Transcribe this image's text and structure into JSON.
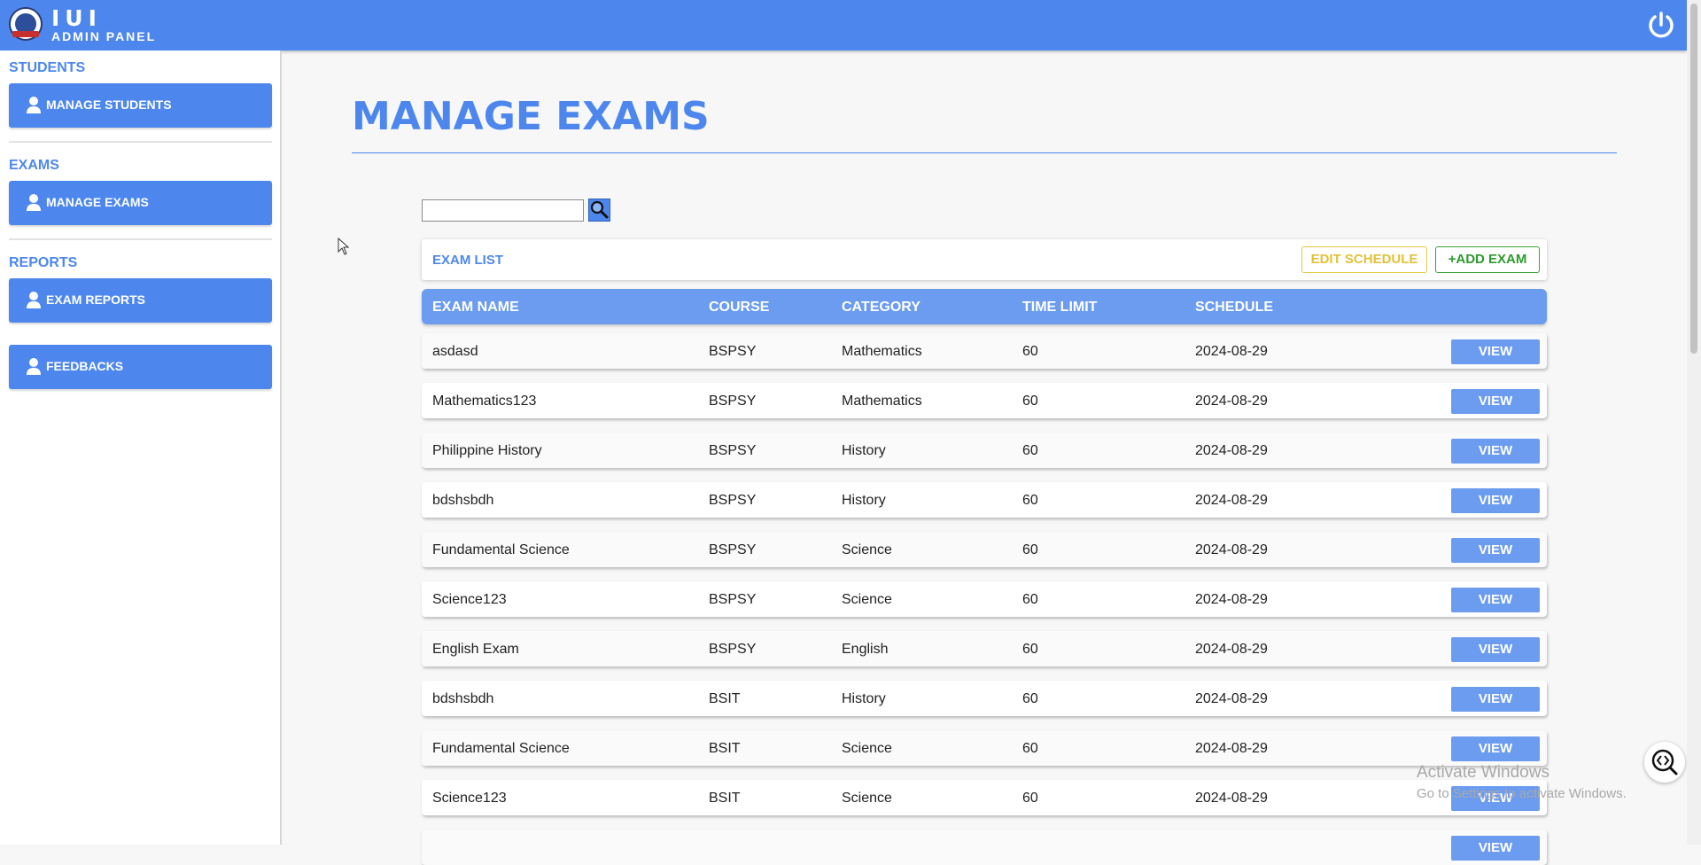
{
  "brand": {
    "title": "IUI",
    "subtitle": "ADMIN PANEL"
  },
  "sidebar": {
    "sections": [
      {
        "heading": "STUDENTS",
        "button": "MANAGE STUDENTS"
      },
      {
        "heading": "EXAMS",
        "button": "MANAGE EXAMS"
      },
      {
        "heading": "REPORTS",
        "button": "EXAM REPORTS"
      }
    ],
    "feedback_button": "FEEDBACKS",
    "icon": "user-icon"
  },
  "page": {
    "title": "MANAGE EXAMS",
    "search_value": "",
    "search_icon": "magnifier-icon"
  },
  "exam_list": {
    "title": "EXAM LIST",
    "edit_schedule_label": "EDIT SCHEDULE",
    "add_exam_label": "+ADD EXAM",
    "columns": [
      "EXAM NAME",
      "COURSE",
      "CATEGORY",
      "TIME LIMIT",
      "SCHEDULE"
    ],
    "view_label": "VIEW",
    "rows": [
      {
        "name": "asdasd",
        "course": "BSPSY",
        "category": "Mathematics",
        "time_limit": "60",
        "schedule": "2024-08-29"
      },
      {
        "name": "Mathematics123",
        "course": "BSPSY",
        "category": "Mathematics",
        "time_limit": "60",
        "schedule": "2024-08-29"
      },
      {
        "name": "Philippine History",
        "course": "BSPSY",
        "category": "History",
        "time_limit": "60",
        "schedule": "2024-08-29"
      },
      {
        "name": "bdshsbdh",
        "course": "BSPSY",
        "category": "History",
        "time_limit": "60",
        "schedule": "2024-08-29"
      },
      {
        "name": "Fundamental Science",
        "course": "BSPSY",
        "category": "Science",
        "time_limit": "60",
        "schedule": "2024-08-29"
      },
      {
        "name": "Science123",
        "course": "BSPSY",
        "category": "Science",
        "time_limit": "60",
        "schedule": "2024-08-29"
      },
      {
        "name": "English Exam",
        "course": "BSPSY",
        "category": "English",
        "time_limit": "60",
        "schedule": "2024-08-29"
      },
      {
        "name": "bdshsbdh",
        "course": "BSIT",
        "category": "History",
        "time_limit": "60",
        "schedule": "2024-08-29"
      },
      {
        "name": "Fundamental Science",
        "course": "BSIT",
        "category": "Science",
        "time_limit": "60",
        "schedule": "2024-08-29"
      },
      {
        "name": "Science123",
        "course": "BSIT",
        "category": "Science",
        "time_limit": "60",
        "schedule": "2024-08-29"
      }
    ]
  },
  "watermark": {
    "line1": "Activate Windows",
    "line2": "Go to Settings to activate Windows."
  },
  "colors": {
    "accent": "#4d87ee",
    "header_row": "#6b9cf0",
    "edit": "#e2c13a",
    "add": "#2e9a2e"
  }
}
